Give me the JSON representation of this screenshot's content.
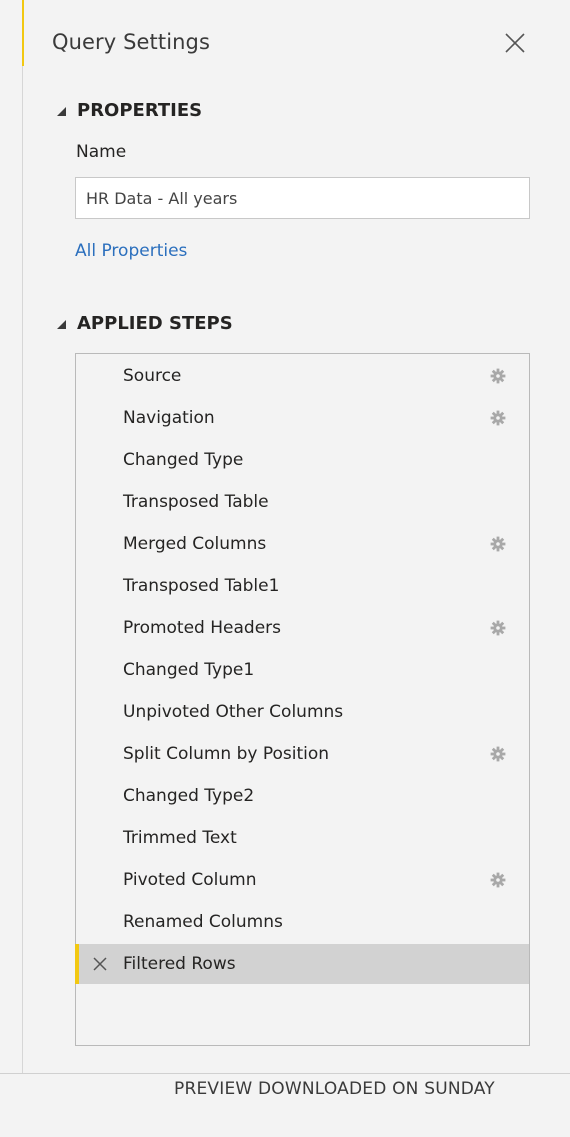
{
  "pane": {
    "title": "Query Settings",
    "close_icon": "close-icon"
  },
  "properties": {
    "header": "PROPERTIES",
    "name_label": "Name",
    "name_value": "HR Data - All years",
    "all_properties_link": "All Properties"
  },
  "applied_steps": {
    "header": "APPLIED STEPS",
    "steps": [
      {
        "label": "Source",
        "has_gear": true
      },
      {
        "label": "Navigation",
        "has_gear": true
      },
      {
        "label": "Changed Type",
        "has_gear": false
      },
      {
        "label": "Transposed Table",
        "has_gear": false
      },
      {
        "label": "Merged Columns",
        "has_gear": true
      },
      {
        "label": "Transposed Table1",
        "has_gear": false
      },
      {
        "label": "Promoted Headers",
        "has_gear": true
      },
      {
        "label": "Changed Type1",
        "has_gear": false
      },
      {
        "label": "Unpivoted Other Columns",
        "has_gear": false
      },
      {
        "label": "Split Column by Position",
        "has_gear": true
      },
      {
        "label": "Changed Type2",
        "has_gear": false
      },
      {
        "label": "Trimmed Text",
        "has_gear": false
      },
      {
        "label": "Pivoted Column",
        "has_gear": true
      },
      {
        "label": "Renamed Columns",
        "has_gear": false
      },
      {
        "label": "Filtered Rows",
        "has_gear": false,
        "selected": true
      }
    ]
  },
  "status_bar": {
    "text": "PREVIEW DOWNLOADED ON SUNDAY"
  },
  "colors": {
    "accent_yellow": "#f2c811",
    "link_blue": "#2b6fbd",
    "selected_bg": "#d2d2d2"
  }
}
